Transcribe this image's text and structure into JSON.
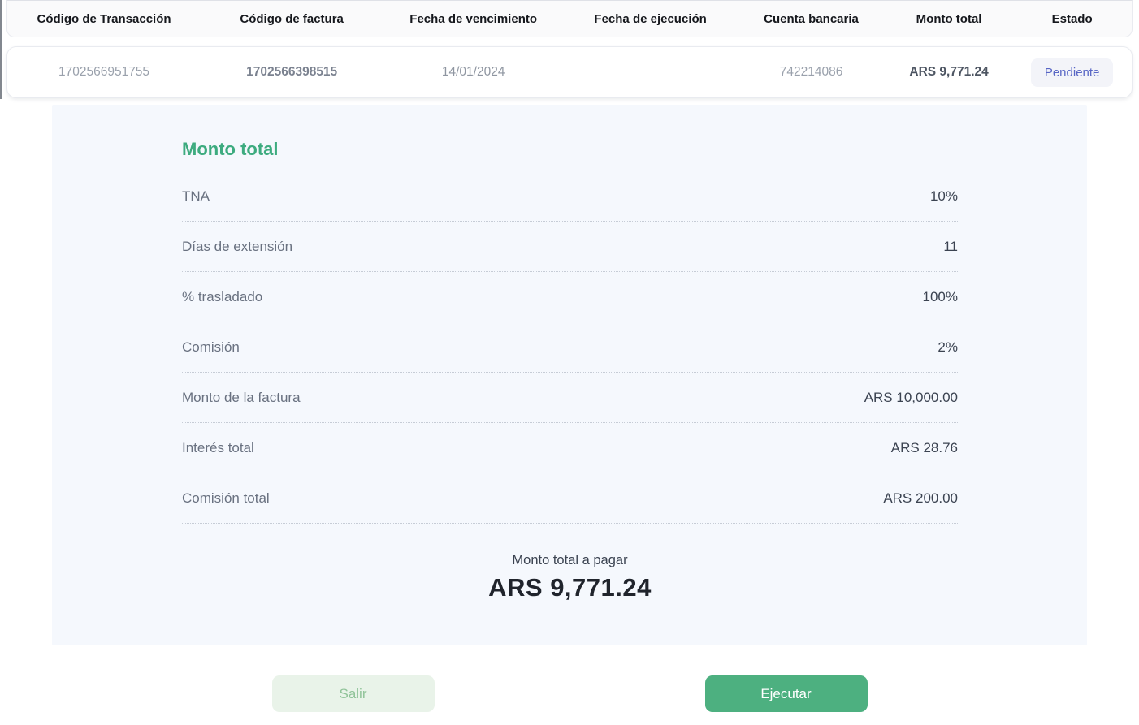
{
  "table": {
    "columns": [
      "Código de Transacción",
      "Código de factura",
      "Fecha de vencimiento",
      "Fecha de ejecución",
      "Cuenta bancaria",
      "Monto total",
      "Estado"
    ],
    "row": {
      "transaction_code": "1702566951755",
      "invoice_code": "1702566398515",
      "due_date": "14/01/2024",
      "execution_date": "",
      "bank_account": "742214086",
      "total_amount": "ARS 9,771.24",
      "status": "Pendiente"
    }
  },
  "panel": {
    "title": "Monto total",
    "rows": [
      {
        "label": "TNA",
        "value": "10%"
      },
      {
        "label": "Días de extensión",
        "value": "11"
      },
      {
        "label": "% trasladado",
        "value": "100%"
      },
      {
        "label": "Comisión",
        "value": "2%"
      },
      {
        "label": "Monto de la factura",
        "value": "ARS 10,000.00"
      },
      {
        "label": "Interés total",
        "value": "ARS 28.76"
      },
      {
        "label": "Comisión total",
        "value": "ARS 200.00"
      }
    ],
    "total": {
      "label": "Monto total a pagar",
      "value": "ARS 9,771.24"
    }
  },
  "actions": {
    "exit_label": "Salir",
    "execute_label": "Ejecutar"
  },
  "colors": {
    "panel_background": "#f5f8fd",
    "title_green": "#3dab7f",
    "execute_button_green": "#4db080",
    "exit_button_background": "#e9f3e9",
    "exit_button_text": "#90c399",
    "status_badge_background": "#f3f4f9",
    "status_badge_text": "#5866c5"
  }
}
